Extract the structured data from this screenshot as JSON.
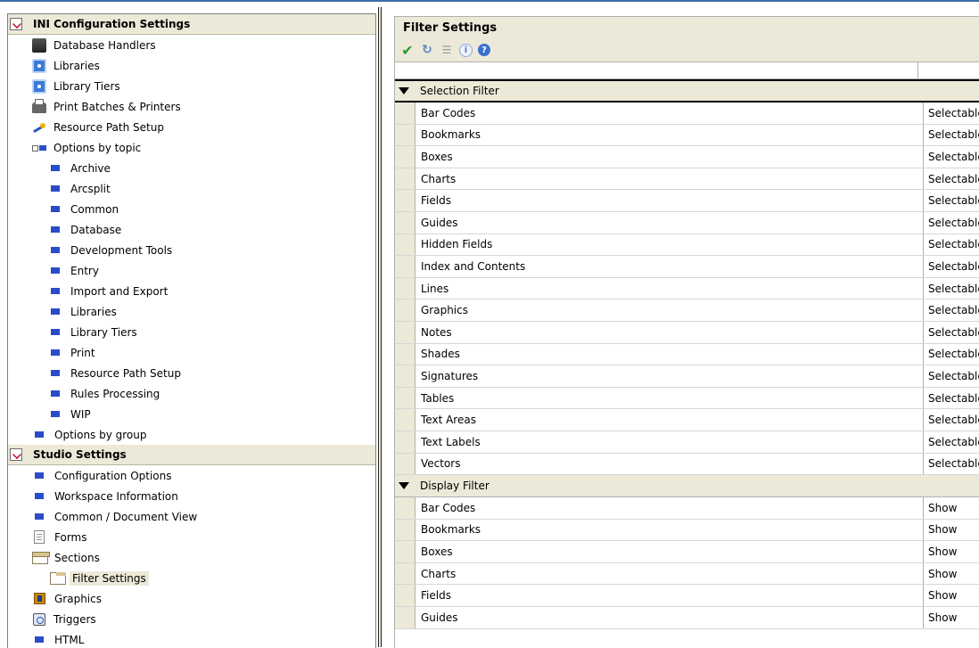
{
  "left_panel": {
    "ini_section": {
      "title": "INI Configuration Settings",
      "items": [
        {
          "label": "Database Handlers",
          "icon": "database-icon"
        },
        {
          "label": "Libraries",
          "icon": "library-icon"
        },
        {
          "label": "Library Tiers",
          "icon": "library-icon"
        },
        {
          "label": "Print Batches & Printers",
          "icon": "printer-icon"
        },
        {
          "label": "Resource Path Setup",
          "icon": "resource-icon"
        }
      ],
      "options_by_topic": {
        "label": "Options by topic",
        "children": [
          "Archive",
          "Arcsplit",
          "Common",
          "Database",
          "Development Tools",
          "Entry",
          "Import and Export",
          "Libraries",
          "Library Tiers",
          "Print",
          "Resource Path Setup",
          "Rules Processing",
          "WIP"
        ]
      },
      "options_by_group": "Options by group"
    },
    "studio_section": {
      "title": "Studio Settings",
      "items": [
        {
          "label": "Configuration Options"
        },
        {
          "label": "Workspace Information"
        },
        {
          "label": "Common / Document View"
        },
        {
          "label": "Forms"
        },
        {
          "label": "Sections"
        },
        {
          "label": "Filter Settings"
        },
        {
          "label": "Graphics"
        },
        {
          "label": "Triggers"
        },
        {
          "label": "HTML"
        }
      ]
    }
  },
  "right_panel": {
    "title": "Filter Settings",
    "toolbar": {
      "check": "✔",
      "refresh": "↻",
      "list": "☰",
      "info": "i",
      "help": "?"
    },
    "selection_filter": {
      "label": "Selection Filter",
      "rows": [
        {
          "name": "Bar Codes",
          "value": "Selectable"
        },
        {
          "name": "Bookmarks",
          "value": "Selectable"
        },
        {
          "name": "Boxes",
          "value": "Selectable"
        },
        {
          "name": "Charts",
          "value": "Selectable"
        },
        {
          "name": "Fields",
          "value": "Selectable"
        },
        {
          "name": "Guides",
          "value": "Selectable"
        },
        {
          "name": "Hidden Fields",
          "value": "Selectable"
        },
        {
          "name": "Index and Contents",
          "value": "Selectable"
        },
        {
          "name": "Lines",
          "value": "Selectable"
        },
        {
          "name": "Graphics",
          "value": "Selectable"
        },
        {
          "name": "Notes",
          "value": "Selectable"
        },
        {
          "name": "Shades",
          "value": "Selectable"
        },
        {
          "name": "Signatures",
          "value": "Selectable"
        },
        {
          "name": "Tables",
          "value": "Selectable"
        },
        {
          "name": "Text Areas",
          "value": "Selectable"
        },
        {
          "name": "Text Labels",
          "value": "Selectable"
        },
        {
          "name": "Vectors",
          "value": "Selectable"
        }
      ]
    },
    "display_filter": {
      "label": "Display Filter",
      "rows": [
        {
          "name": "Bar Codes",
          "value": "Show"
        },
        {
          "name": "Bookmarks",
          "value": "Show"
        },
        {
          "name": "Boxes",
          "value": "Show"
        },
        {
          "name": "Charts",
          "value": "Show"
        },
        {
          "name": "Fields",
          "value": "Show"
        },
        {
          "name": "Guides",
          "value": "Show"
        }
      ]
    }
  }
}
